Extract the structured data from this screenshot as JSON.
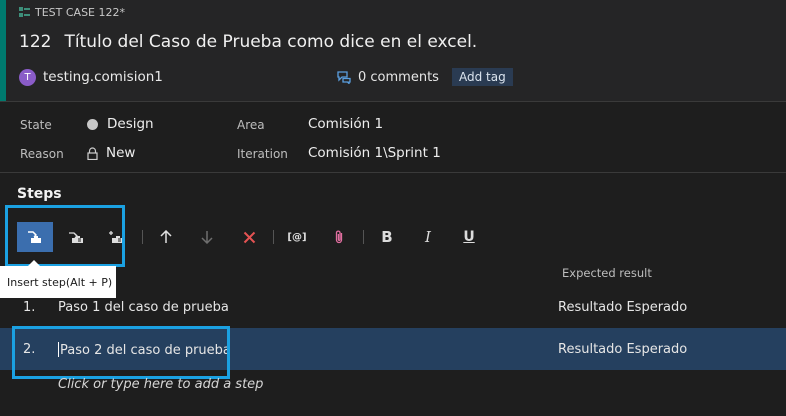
{
  "header": {
    "type_label": "TEST CASE 122*",
    "id": "122",
    "title": "Título del Caso de Prueba como dice en el excel.",
    "avatar_letter": "T",
    "user": "testing.comision1",
    "comments": "0 comments",
    "add_tag": "Add tag",
    "accent_color": "#007a6e"
  },
  "fields": {
    "state_label": "State",
    "state_value": "Design",
    "reason_label": "Reason",
    "reason_value": "New",
    "area_label": "Area",
    "area_value": "Comisión 1",
    "iteration_label": "Iteration",
    "iteration_value": "Comisión 1\\Sprint 1"
  },
  "steps": {
    "title": "Steps",
    "tooltip": "Insert step(Alt + P)",
    "expected_header": "Expected result",
    "rows": [
      {
        "num": "1.",
        "action": "Paso 1 del caso de prueba",
        "expected": "Resultado Esperado"
      },
      {
        "num": "2.",
        "action": "Paso 2 del caso de prueba",
        "expected": "Resultado Esperado"
      }
    ],
    "add_step": "Click or type here to add a step"
  },
  "toolbar": {
    "icons": [
      "insert-step-icon",
      "insert-shared-steps-icon",
      "create-shared-steps-icon",
      "move-up-icon",
      "move-down-icon",
      "delete-icon",
      "insert-parameter-icon",
      "attachment-icon",
      "bold-icon",
      "italic-icon",
      "underline-icon"
    ],
    "bold": "B",
    "italic": "I",
    "underline": "U",
    "parameter": "[@]"
  }
}
